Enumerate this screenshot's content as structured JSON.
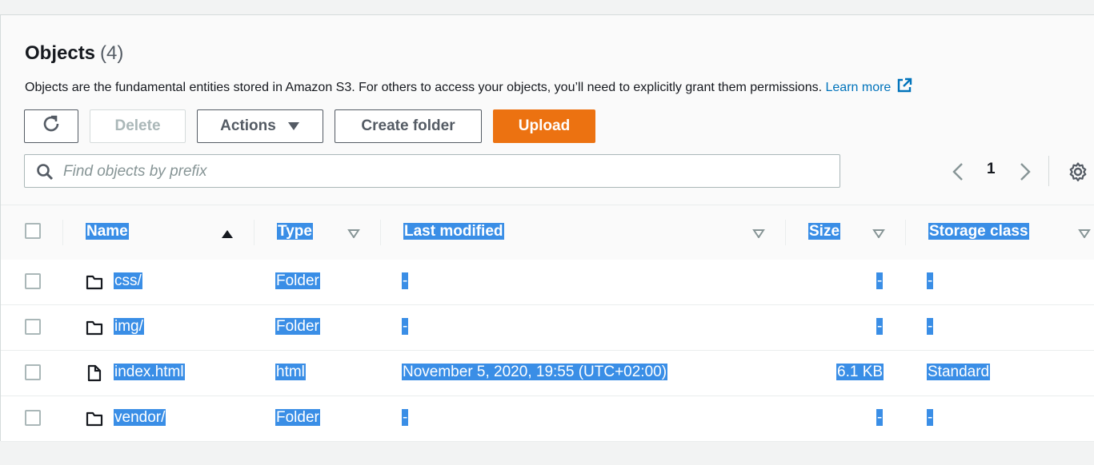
{
  "header": {
    "title": "Objects",
    "count": "(4)",
    "description": "Objects are the fundamental entities stored in Amazon S3. For others to access your objects, you’ll need to explicitly grant them permissions.",
    "learn_more": "Learn more"
  },
  "toolbar": {
    "delete_label": "Delete",
    "actions_label": "Actions",
    "create_folder_label": "Create folder",
    "upload_label": "Upload"
  },
  "search": {
    "placeholder": "Find objects by prefix"
  },
  "pagination": {
    "current_page": "1"
  },
  "table": {
    "columns": [
      "Name",
      "Type",
      "Last modified",
      "Size",
      "Storage class"
    ],
    "sort": {
      "column": "Name",
      "direction": "ascending"
    },
    "rows": [
      {
        "icon": "folder-icon",
        "name": "css/",
        "type": "Folder",
        "last_modified": "-",
        "size": "-",
        "storage_class": "-"
      },
      {
        "icon": "folder-icon",
        "name": "img/",
        "type": "Folder",
        "last_modified": "-",
        "size": "-",
        "storage_class": "-"
      },
      {
        "icon": "file-icon",
        "name": "index.html",
        "type": "html",
        "last_modified": "November 5, 2020, 19:55 (UTC+02:00)",
        "size": "6.1 KB",
        "storage_class": "Standard"
      },
      {
        "icon": "folder-icon",
        "name": "vendor/",
        "type": "Folder",
        "last_modified": "-",
        "size": "-",
        "storage_class": "-"
      }
    ]
  },
  "colors": {
    "primary": "#ec7211",
    "link": "#0073bb",
    "selection_highlight": "#3a8ee6"
  }
}
